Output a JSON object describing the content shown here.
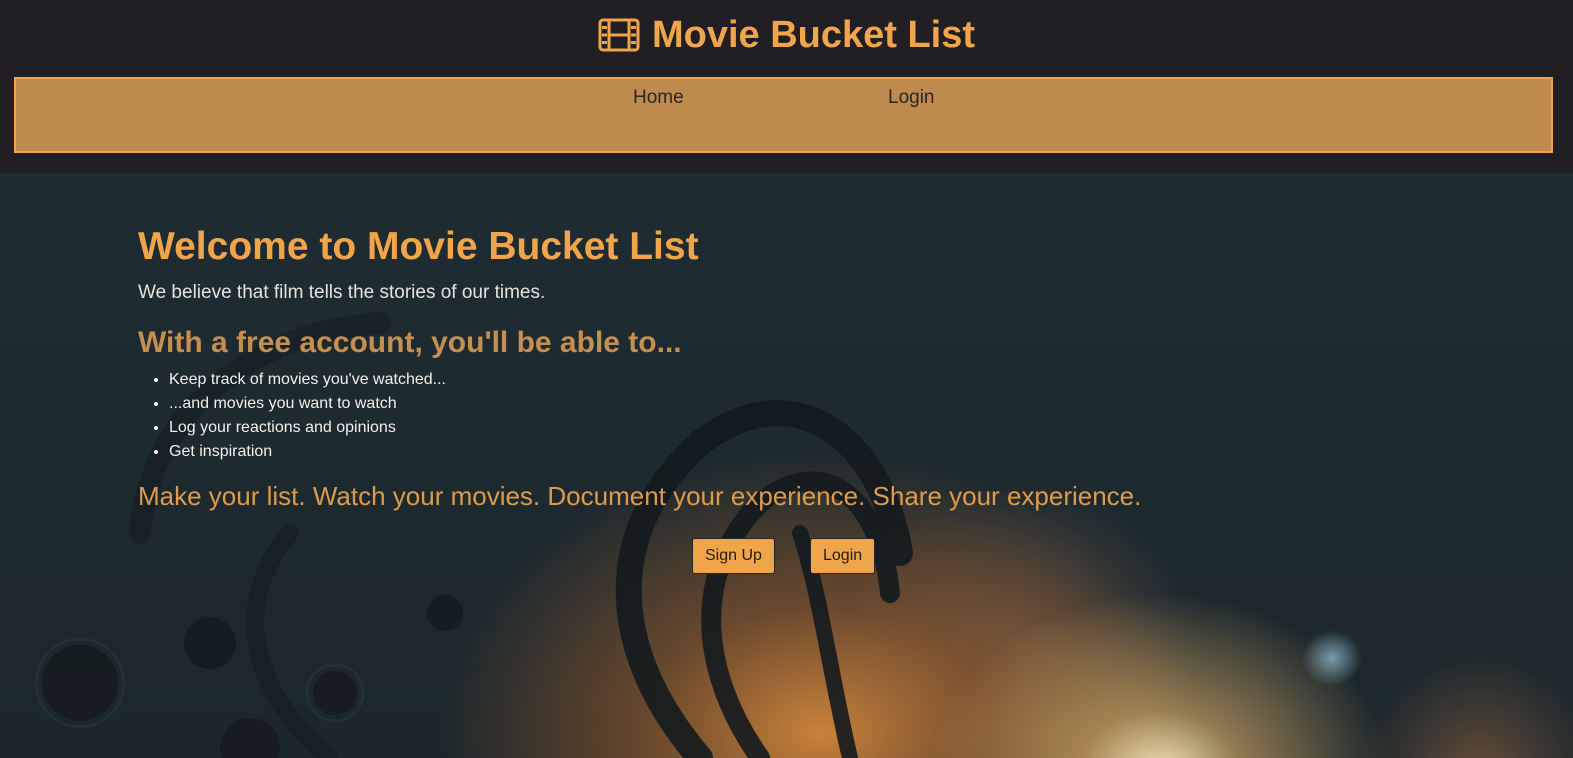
{
  "app": {
    "title": "Movie Bucket List",
    "icon": "film-icon",
    "accent_color": "#f0a54a"
  },
  "navbar": {
    "items": [
      {
        "label": "Home"
      },
      {
        "label": "Login"
      }
    ]
  },
  "hero": {
    "welcome": "Welcome to Movie Bucket List",
    "tagline": "We believe that film tells the stories of our times.",
    "subhead": "With a free account, you'll be able to...",
    "features": [
      "Keep track of movies you've watched...",
      "...and movies you want to watch",
      "Log your reactions and opinions",
      "Get inspiration"
    ],
    "motto": "Make your list. Watch your movies. Document your experience. Share your experience.",
    "signup_label": "Sign Up",
    "login_label": "Login"
  }
}
